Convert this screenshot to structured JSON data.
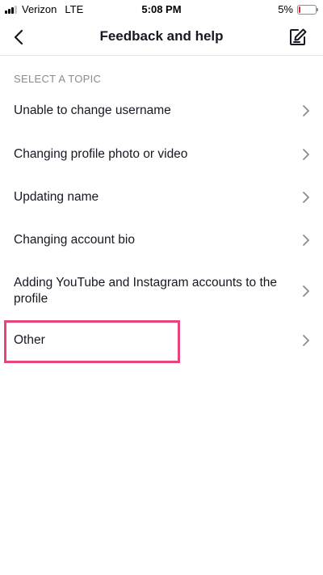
{
  "status_bar": {
    "carrier": "Verizon",
    "network": "LTE",
    "time": "5:08 PM",
    "battery_percent": "5%",
    "battery_level": 0.05,
    "battery_color": "#d7262b"
  },
  "header": {
    "title": "Feedback and help",
    "back_icon": "chevron-left-icon",
    "action_icon": "compose-icon"
  },
  "section": {
    "title": "SELECT A TOPIC"
  },
  "topics": [
    {
      "label": "Unable to change username"
    },
    {
      "label": "Changing profile photo or video"
    },
    {
      "label": "Updating name"
    },
    {
      "label": "Changing account bio"
    },
    {
      "label": "Adding YouTube and Instagram accounts to the profile"
    },
    {
      "label": "Other"
    }
  ],
  "highlight": {
    "target": "Other",
    "color": "#e8467a"
  },
  "colors": {
    "text": "#161823",
    "secondary_text": "#8a8b91",
    "chevron": "#8a8b91",
    "divider": "#e3e3e4"
  }
}
